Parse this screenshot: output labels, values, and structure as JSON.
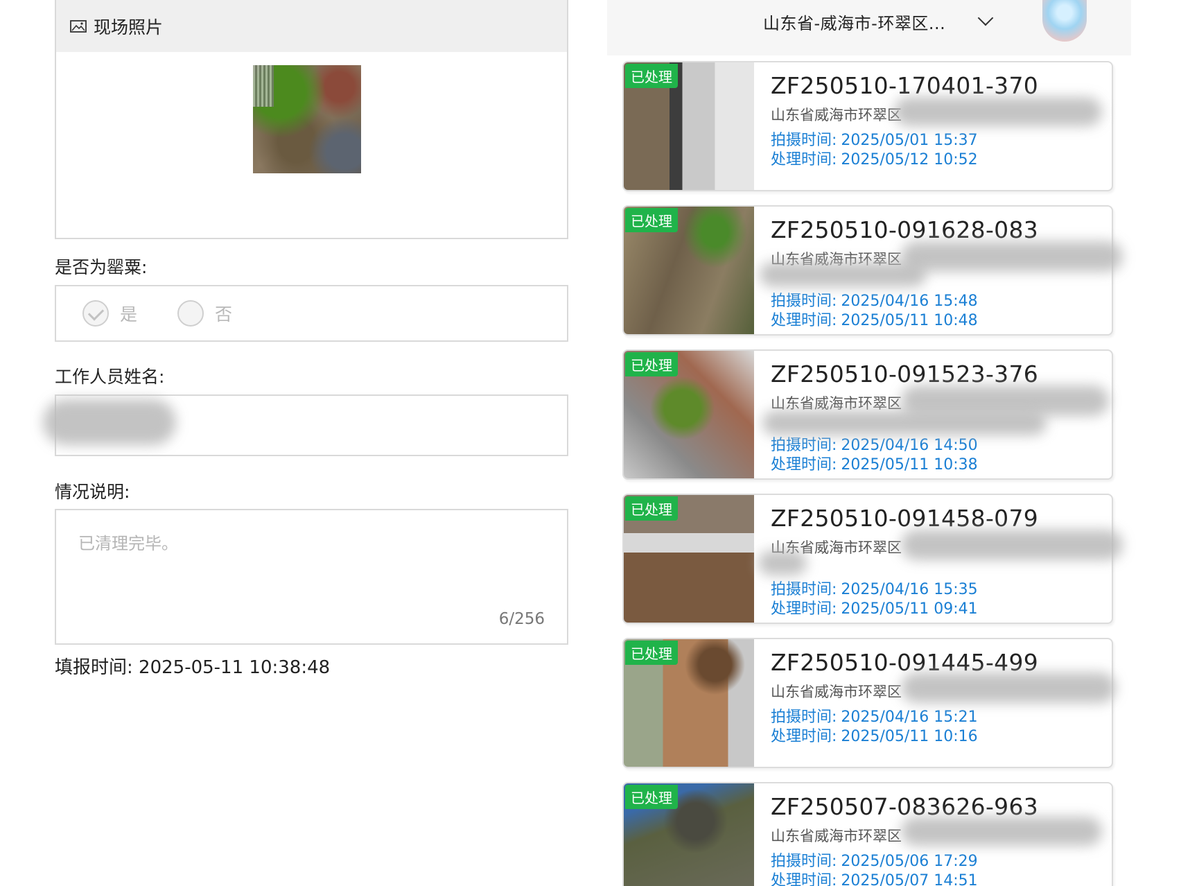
{
  "form": {
    "photo_section": {
      "title": "现场照片",
      "icon": "image-icon"
    },
    "poppy_question": {
      "label": "是否为罂粟:",
      "options": [
        {
          "label": "是",
          "checked": true
        },
        {
          "label": "否",
          "checked": false
        }
      ]
    },
    "staff_name": {
      "label": "工作人员姓名:"
    },
    "description": {
      "label": "情况说明:",
      "value": "已清理完毕。",
      "count": "6/256"
    },
    "report_time": {
      "label": "填报时间:",
      "value": "2025-05-11 10:38:48"
    }
  },
  "list": {
    "region_select": "山东省-威海市-环翠区...",
    "cards": [
      {
        "badge": "已处理",
        "title": "ZF250510-170401-370",
        "address": "山东省威海市环翠区",
        "shot_label": "拍摄时间:",
        "shot_time": "2025/05/01 15:37",
        "processed_label": "处理时间:",
        "processed_time": "2025/05/12 10:52"
      },
      {
        "badge": "已处理",
        "title": "ZF250510-091628-083",
        "address": "山东省威海市环翠区",
        "shot_label": "拍摄时间:",
        "shot_time": "2025/04/16 15:48",
        "processed_label": "处理时间:",
        "processed_time": "2025/05/11 10:48"
      },
      {
        "badge": "已处理",
        "title": "ZF250510-091523-376",
        "address": "山东省威海市环翠区",
        "shot_label": "拍摄时间:",
        "shot_time": "2025/04/16 14:50",
        "processed_label": "处理时间:",
        "processed_time": "2025/05/11 10:38"
      },
      {
        "badge": "已处理",
        "title": "ZF250510-091458-079",
        "address": "山东省威海市环翠区",
        "shot_label": "拍摄时间:",
        "shot_time": "2025/04/16 15:35",
        "processed_label": "处理时间:",
        "processed_time": "2025/05/11 09:41"
      },
      {
        "badge": "已处理",
        "title": "ZF250510-091445-499",
        "address": "山东省威海市环翠区",
        "shot_label": "拍摄时间:",
        "shot_time": "2025/04/16 15:21",
        "processed_label": "处理时间:",
        "processed_time": "2025/05/11 10:16"
      },
      {
        "badge": "已处理",
        "title": "ZF250507-083626-963",
        "address": "山东省威海市环翠区",
        "shot_label": "拍摄时间:",
        "shot_time": "2025/05/06 17:29",
        "processed_label": "处理时间:",
        "processed_time": "2025/05/07 14:51"
      }
    ]
  },
  "colors": {
    "badge": "#20b34a",
    "time_text": "#1a7fd4",
    "border": "#d9d9d9"
  }
}
